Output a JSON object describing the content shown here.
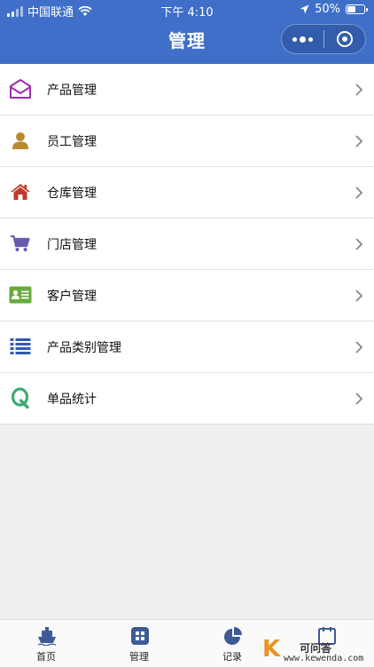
{
  "status_bar": {
    "carrier": "中国联通",
    "time": "下午 4:10",
    "battery": "50%",
    "battery_level": 0.5
  },
  "header": {
    "title": "管理",
    "bg_color": "#3f6fc8"
  },
  "menu": [
    {
      "label": "产品管理",
      "icon": "envelope-icon",
      "color": "#9a2fa8"
    },
    {
      "label": "员工管理",
      "icon": "user-icon",
      "color": "#b98a2c"
    },
    {
      "label": "仓库管理",
      "icon": "home-icon",
      "color": "#c0392b"
    },
    {
      "label": "门店管理",
      "icon": "cart-icon",
      "color": "#6b5bab"
    },
    {
      "label": "客户管理",
      "icon": "contact-card-icon",
      "color": "#6aa940"
    },
    {
      "label": "产品类别管理",
      "icon": "list-icon",
      "color": "#2f5cb0"
    },
    {
      "label": "单品统计",
      "icon": "q-icon",
      "color": "#3faa70"
    }
  ],
  "tabs": [
    {
      "label": "首页",
      "icon": "ship-icon"
    },
    {
      "label": "管理",
      "icon": "grid-icon"
    },
    {
      "label": "记录",
      "icon": "pie-chart-icon"
    },
    {
      "label": "",
      "icon": "calendar-icon"
    }
  ],
  "watermark": {
    "letter": "K",
    "name": "可问答",
    "url": "www.kewenda.com"
  }
}
